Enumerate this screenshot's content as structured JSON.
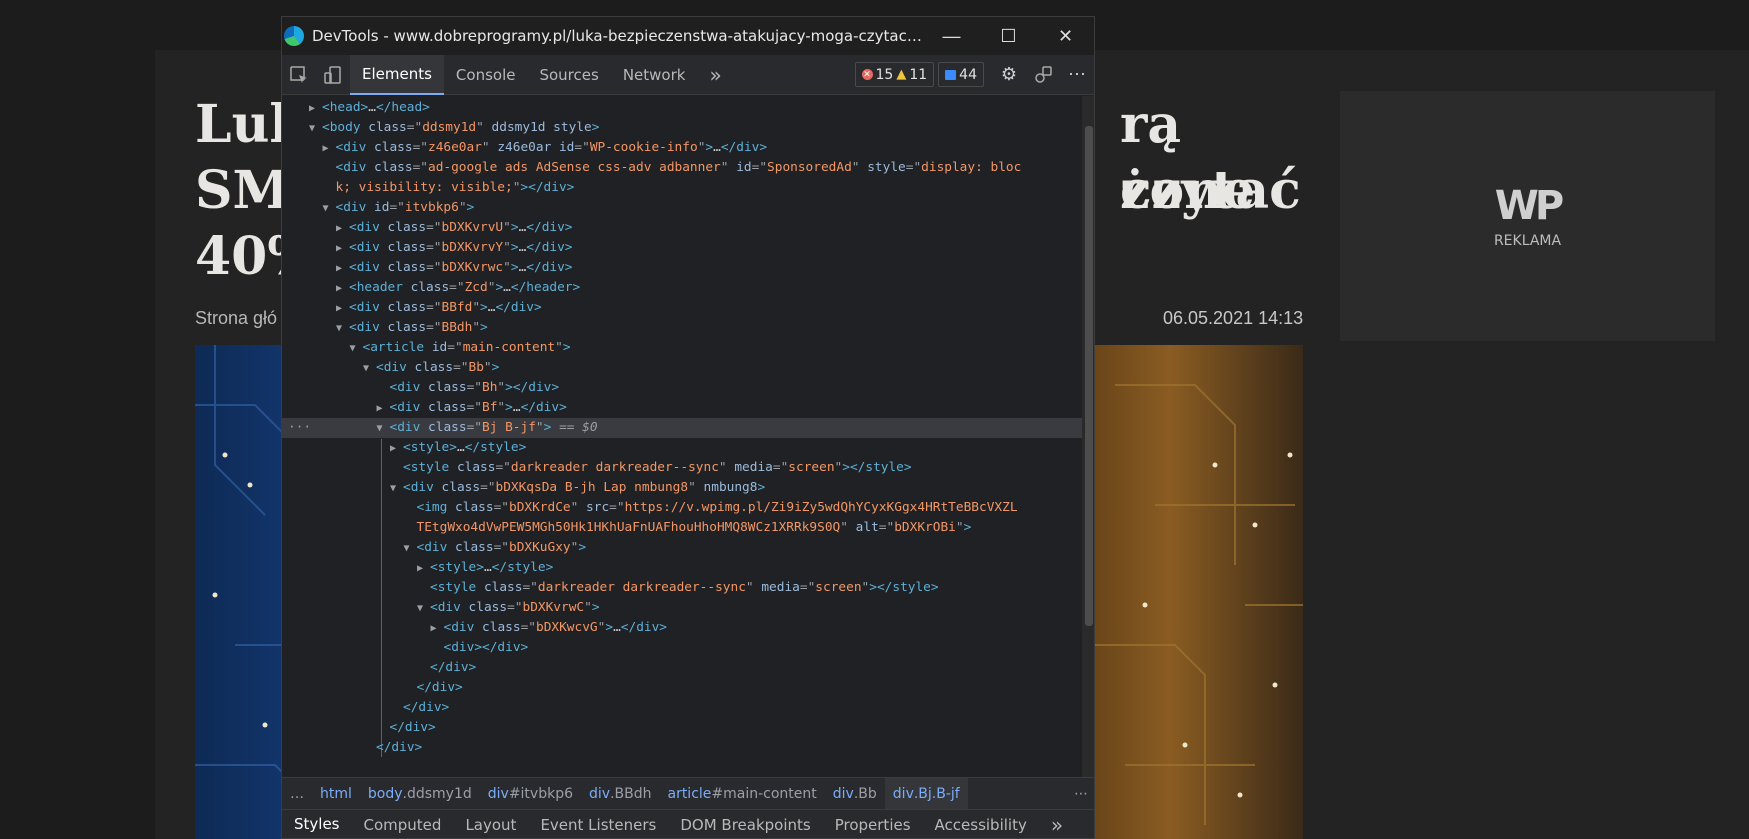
{
  "background_page": {
    "headline_lines": [
      "Luka",
      "SMS",
      "40%"
    ],
    "headline_right_lines": [
      "rą czytać",
      "żone"
    ],
    "byline": "Strona głó",
    "date": "06.05.2021 14:13",
    "ad": {
      "logo": "WP",
      "label": "REKLAMA"
    }
  },
  "devtools": {
    "title": "DevTools - www.dobreprogramy.pl/luka-bezpieczenstwa-atakujacy-moga-czytac-sms-y-i-p...",
    "window_buttons": {
      "minimize": "—",
      "maximize": "☐",
      "close": "✕"
    },
    "tabs": [
      "Elements",
      "Console",
      "Sources",
      "Network"
    ],
    "more_tabs": "»",
    "counts": {
      "errors": "15",
      "warnings": "11",
      "messages": "44"
    },
    "more": "⋯",
    "tree": [
      {
        "indent": 0,
        "caret": "▶",
        "parts": [
          [
            "tg",
            "<head>"
          ],
          [
            "tx",
            "…"
          ],
          [
            "tg",
            "</head>"
          ]
        ]
      },
      {
        "indent": 0,
        "caret": "▼",
        "parts": [
          [
            "tg",
            "<body "
          ],
          [
            "an",
            "class"
          ],
          [
            "eq",
            "=\""
          ],
          [
            "av",
            "ddsmy1d"
          ],
          [
            "eq",
            "\" "
          ],
          [
            "an",
            "ddsmy1d style"
          ],
          [
            "tg",
            ">"
          ]
        ]
      },
      {
        "indent": 1,
        "caret": "▶",
        "parts": [
          [
            "tg",
            "<div "
          ],
          [
            "an",
            "class"
          ],
          [
            "eq",
            "=\""
          ],
          [
            "av",
            "z46e0ar"
          ],
          [
            "eq",
            "\" "
          ],
          [
            "an",
            "z46e0ar id"
          ],
          [
            "eq",
            "=\""
          ],
          [
            "av",
            "WP-cookie-info"
          ],
          [
            "eq",
            "\""
          ],
          [
            "tg",
            ">"
          ],
          [
            "tx",
            "…"
          ],
          [
            "tg",
            "</div>"
          ]
        ]
      },
      {
        "indent": 1,
        "caret": "",
        "parts": [
          [
            "tg",
            "<div "
          ],
          [
            "an",
            "class"
          ],
          [
            "eq",
            "=\""
          ],
          [
            "av",
            "ad-google ads AdSense css-adv adbanner"
          ],
          [
            "eq",
            "\" "
          ],
          [
            "an",
            "id"
          ],
          [
            "eq",
            "=\""
          ],
          [
            "av",
            "SponsoredAd"
          ],
          [
            "eq",
            "\" "
          ],
          [
            "an",
            "style"
          ],
          [
            "eq",
            "=\""
          ],
          [
            "av",
            "display: bloc"
          ]
        ]
      },
      {
        "indent": 1,
        "caret": "",
        "parts": [
          [
            "av",
            "k; visibility: visible;"
          ],
          [
            "eq",
            "\""
          ],
          [
            "tg",
            "></div>"
          ]
        ]
      },
      {
        "indent": 1,
        "caret": "▼",
        "parts": [
          [
            "tg",
            "<div "
          ],
          [
            "an",
            "id"
          ],
          [
            "eq",
            "=\""
          ],
          [
            "av",
            "itvbkp6"
          ],
          [
            "eq",
            "\""
          ],
          [
            "tg",
            ">"
          ]
        ]
      },
      {
        "indent": 2,
        "caret": "▶",
        "parts": [
          [
            "tg",
            "<div "
          ],
          [
            "an",
            "class"
          ],
          [
            "eq",
            "=\""
          ],
          [
            "av",
            "bDXKvrvU"
          ],
          [
            "eq",
            "\""
          ],
          [
            "tg",
            ">"
          ],
          [
            "tx",
            "…"
          ],
          [
            "tg",
            "</div>"
          ]
        ]
      },
      {
        "indent": 2,
        "caret": "▶",
        "parts": [
          [
            "tg",
            "<div "
          ],
          [
            "an",
            "class"
          ],
          [
            "eq",
            "=\""
          ],
          [
            "av",
            "bDXKvrvY"
          ],
          [
            "eq",
            "\""
          ],
          [
            "tg",
            ">"
          ],
          [
            "tx",
            "…"
          ],
          [
            "tg",
            "</div>"
          ]
        ]
      },
      {
        "indent": 2,
        "caret": "▶",
        "parts": [
          [
            "tg",
            "<div "
          ],
          [
            "an",
            "class"
          ],
          [
            "eq",
            "=\""
          ],
          [
            "av",
            "bDXKvrwc"
          ],
          [
            "eq",
            "\""
          ],
          [
            "tg",
            ">"
          ],
          [
            "tx",
            "…"
          ],
          [
            "tg",
            "</div>"
          ]
        ]
      },
      {
        "indent": 2,
        "caret": "▶",
        "parts": [
          [
            "tg",
            "<header "
          ],
          [
            "an",
            "class"
          ],
          [
            "eq",
            "=\""
          ],
          [
            "av",
            "Zcd"
          ],
          [
            "eq",
            "\""
          ],
          [
            "tg",
            ">"
          ],
          [
            "tx",
            "…"
          ],
          [
            "tg",
            "</header>"
          ]
        ]
      },
      {
        "indent": 2,
        "caret": "▶",
        "parts": [
          [
            "tg",
            "<div "
          ],
          [
            "an",
            "class"
          ],
          [
            "eq",
            "=\""
          ],
          [
            "av",
            "BBfd"
          ],
          [
            "eq",
            "\""
          ],
          [
            "tg",
            ">"
          ],
          [
            "tx",
            "…"
          ],
          [
            "tg",
            "</div>"
          ]
        ]
      },
      {
        "indent": 2,
        "caret": "▼",
        "parts": [
          [
            "tg",
            "<div "
          ],
          [
            "an",
            "class"
          ],
          [
            "eq",
            "=\""
          ],
          [
            "av",
            "BBdh"
          ],
          [
            "eq",
            "\""
          ],
          [
            "tg",
            ">"
          ]
        ]
      },
      {
        "indent": 3,
        "caret": "▼",
        "parts": [
          [
            "tg",
            "<article "
          ],
          [
            "an",
            "id"
          ],
          [
            "eq",
            "=\""
          ],
          [
            "av",
            "main-content"
          ],
          [
            "eq",
            "\""
          ],
          [
            "tg",
            ">"
          ]
        ]
      },
      {
        "indent": 4,
        "caret": "▼",
        "parts": [
          [
            "tg",
            "<div "
          ],
          [
            "an",
            "class"
          ],
          [
            "eq",
            "=\""
          ],
          [
            "av",
            "Bb"
          ],
          [
            "eq",
            "\""
          ],
          [
            "tg",
            ">"
          ]
        ]
      },
      {
        "indent": 5,
        "caret": "",
        "parts": [
          [
            "tg",
            "<div "
          ],
          [
            "an",
            "class"
          ],
          [
            "eq",
            "=\""
          ],
          [
            "av",
            "Bh"
          ],
          [
            "eq",
            "\""
          ],
          [
            "tg",
            "></div>"
          ]
        ]
      },
      {
        "indent": 5,
        "caret": "▶",
        "parts": [
          [
            "tg",
            "<div "
          ],
          [
            "an",
            "class"
          ],
          [
            "eq",
            "=\""
          ],
          [
            "av",
            "Bf"
          ],
          [
            "eq",
            "\""
          ],
          [
            "tg",
            ">"
          ],
          [
            "tx",
            "…"
          ],
          [
            "tg",
            "</div>"
          ]
        ]
      },
      {
        "indent": 5,
        "caret": "▼",
        "selected": true,
        "parts": [
          [
            "tg",
            "<div "
          ],
          [
            "an",
            "class"
          ],
          [
            "eq",
            "=\""
          ],
          [
            "av",
            "Bj B-jf"
          ],
          [
            "eq",
            "\""
          ],
          [
            "tg",
            ">"
          ],
          [
            "gl",
            " == $0"
          ]
        ]
      },
      {
        "indent": 6,
        "caret": "▶",
        "parts": [
          [
            "tg",
            "<style>"
          ],
          [
            "tx",
            "…"
          ],
          [
            "tg",
            "</style>"
          ]
        ]
      },
      {
        "indent": 6,
        "caret": "",
        "parts": [
          [
            "tg",
            "<style "
          ],
          [
            "an",
            "class"
          ],
          [
            "eq",
            "=\""
          ],
          [
            "av",
            "darkreader darkreader--sync"
          ],
          [
            "eq",
            "\" "
          ],
          [
            "an",
            "media"
          ],
          [
            "eq",
            "=\""
          ],
          [
            "av",
            "screen"
          ],
          [
            "eq",
            "\""
          ],
          [
            "tg",
            "></style>"
          ]
        ]
      },
      {
        "indent": 6,
        "caret": "▼",
        "parts": [
          [
            "tg",
            "<div "
          ],
          [
            "an",
            "class"
          ],
          [
            "eq",
            "=\""
          ],
          [
            "av",
            "bDXKqsDa B-jh Lap nmbung8"
          ],
          [
            "eq",
            "\" "
          ],
          [
            "an",
            "nmbung8"
          ],
          [
            "tg",
            ">"
          ]
        ]
      },
      {
        "indent": 7,
        "caret": "",
        "parts": [
          [
            "tg",
            "<img "
          ],
          [
            "an",
            "class"
          ],
          [
            "eq",
            "=\""
          ],
          [
            "av",
            "bDXKrdCe"
          ],
          [
            "eq",
            "\" "
          ],
          [
            "an",
            "src"
          ],
          [
            "eq",
            "=\""
          ],
          [
            "av",
            "https://v.wpimg.pl/Zi9iZy5wdQhYCyxKGgx4HRtTeBBcVXZL"
          ]
        ]
      },
      {
        "indent": 7,
        "caret": "",
        "parts": [
          [
            "av",
            "TEtgWxo4dVwPEW5MGh50Hk1HKhUaFnUAFhouHhoHMQ8WCz1XRRk9S0Q"
          ],
          [
            "eq",
            "\" "
          ],
          [
            "an",
            "alt"
          ],
          [
            "eq",
            "=\""
          ],
          [
            "av",
            "bDXKrOBi"
          ],
          [
            "eq",
            "\""
          ],
          [
            "tg",
            ">"
          ]
        ]
      },
      {
        "indent": 7,
        "caret": "▼",
        "parts": [
          [
            "tg",
            "<div "
          ],
          [
            "an",
            "class"
          ],
          [
            "eq",
            "=\""
          ],
          [
            "av",
            "bDXKuGxy"
          ],
          [
            "eq",
            "\""
          ],
          [
            "tg",
            ">"
          ]
        ]
      },
      {
        "indent": 8,
        "caret": "▶",
        "parts": [
          [
            "tg",
            "<style>"
          ],
          [
            "tx",
            "…"
          ],
          [
            "tg",
            "</style>"
          ]
        ]
      },
      {
        "indent": 8,
        "caret": "",
        "parts": [
          [
            "tg",
            "<style "
          ],
          [
            "an",
            "class"
          ],
          [
            "eq",
            "=\""
          ],
          [
            "av",
            "darkreader darkreader--sync"
          ],
          [
            "eq",
            "\" "
          ],
          [
            "an",
            "media"
          ],
          [
            "eq",
            "=\""
          ],
          [
            "av",
            "screen"
          ],
          [
            "eq",
            "\""
          ],
          [
            "tg",
            "></style>"
          ]
        ]
      },
      {
        "indent": 8,
        "caret": "▼",
        "parts": [
          [
            "tg",
            "<div "
          ],
          [
            "an",
            "class"
          ],
          [
            "eq",
            "=\""
          ],
          [
            "av",
            "bDXKvrwC"
          ],
          [
            "eq",
            "\""
          ],
          [
            "tg",
            ">"
          ]
        ]
      },
      {
        "indent": 9,
        "caret": "▶",
        "parts": [
          [
            "tg",
            "<div "
          ],
          [
            "an",
            "class"
          ],
          [
            "eq",
            "=\""
          ],
          [
            "av",
            "bDXKwcvG"
          ],
          [
            "eq",
            "\""
          ],
          [
            "tg",
            ">"
          ],
          [
            "tx",
            "…"
          ],
          [
            "tg",
            "</div>"
          ]
        ]
      },
      {
        "indent": 9,
        "caret": "",
        "parts": [
          [
            "tg",
            "<div></div>"
          ]
        ]
      },
      {
        "indent": 8,
        "caret": "",
        "parts": [
          [
            "tg",
            "</div>"
          ]
        ]
      },
      {
        "indent": 7,
        "caret": "",
        "parts": [
          [
            "tg",
            "</div>"
          ]
        ]
      },
      {
        "indent": 6,
        "caret": "",
        "parts": [
          [
            "tg",
            "</div>"
          ]
        ]
      },
      {
        "indent": 5,
        "caret": "",
        "parts": [
          [
            "tg",
            "</div>"
          ]
        ]
      },
      {
        "indent": 4,
        "caret": "",
        "parts": [
          [
            "tg",
            "</div>"
          ]
        ]
      }
    ],
    "breadcrumbs": {
      "ellipsis": "…",
      "items": [
        {
          "tag": "html",
          "rest": ""
        },
        {
          "tag": "body",
          "rest": ".ddsmy1d"
        },
        {
          "tag": "div",
          "rest": "#itvbkp6"
        },
        {
          "tag": "div",
          "rest": ".BBdh"
        },
        {
          "tag": "article",
          "rest": "#main-content"
        },
        {
          "tag": "div",
          "rest": ".Bb"
        },
        {
          "tag": "div",
          "rest": ".Bj.B-jf"
        }
      ],
      "more": "⋯"
    },
    "lower_tabs": [
      "Styles",
      "Computed",
      "Layout",
      "Event Listeners",
      "DOM Breakpoints",
      "Properties",
      "Accessibility"
    ],
    "lower_more": "»",
    "colors": {
      "accent": "#7cacf8",
      "tag": "#5db0d7",
      "attr_name": "#9bbbdc",
      "attr_value": "#f29766"
    }
  }
}
